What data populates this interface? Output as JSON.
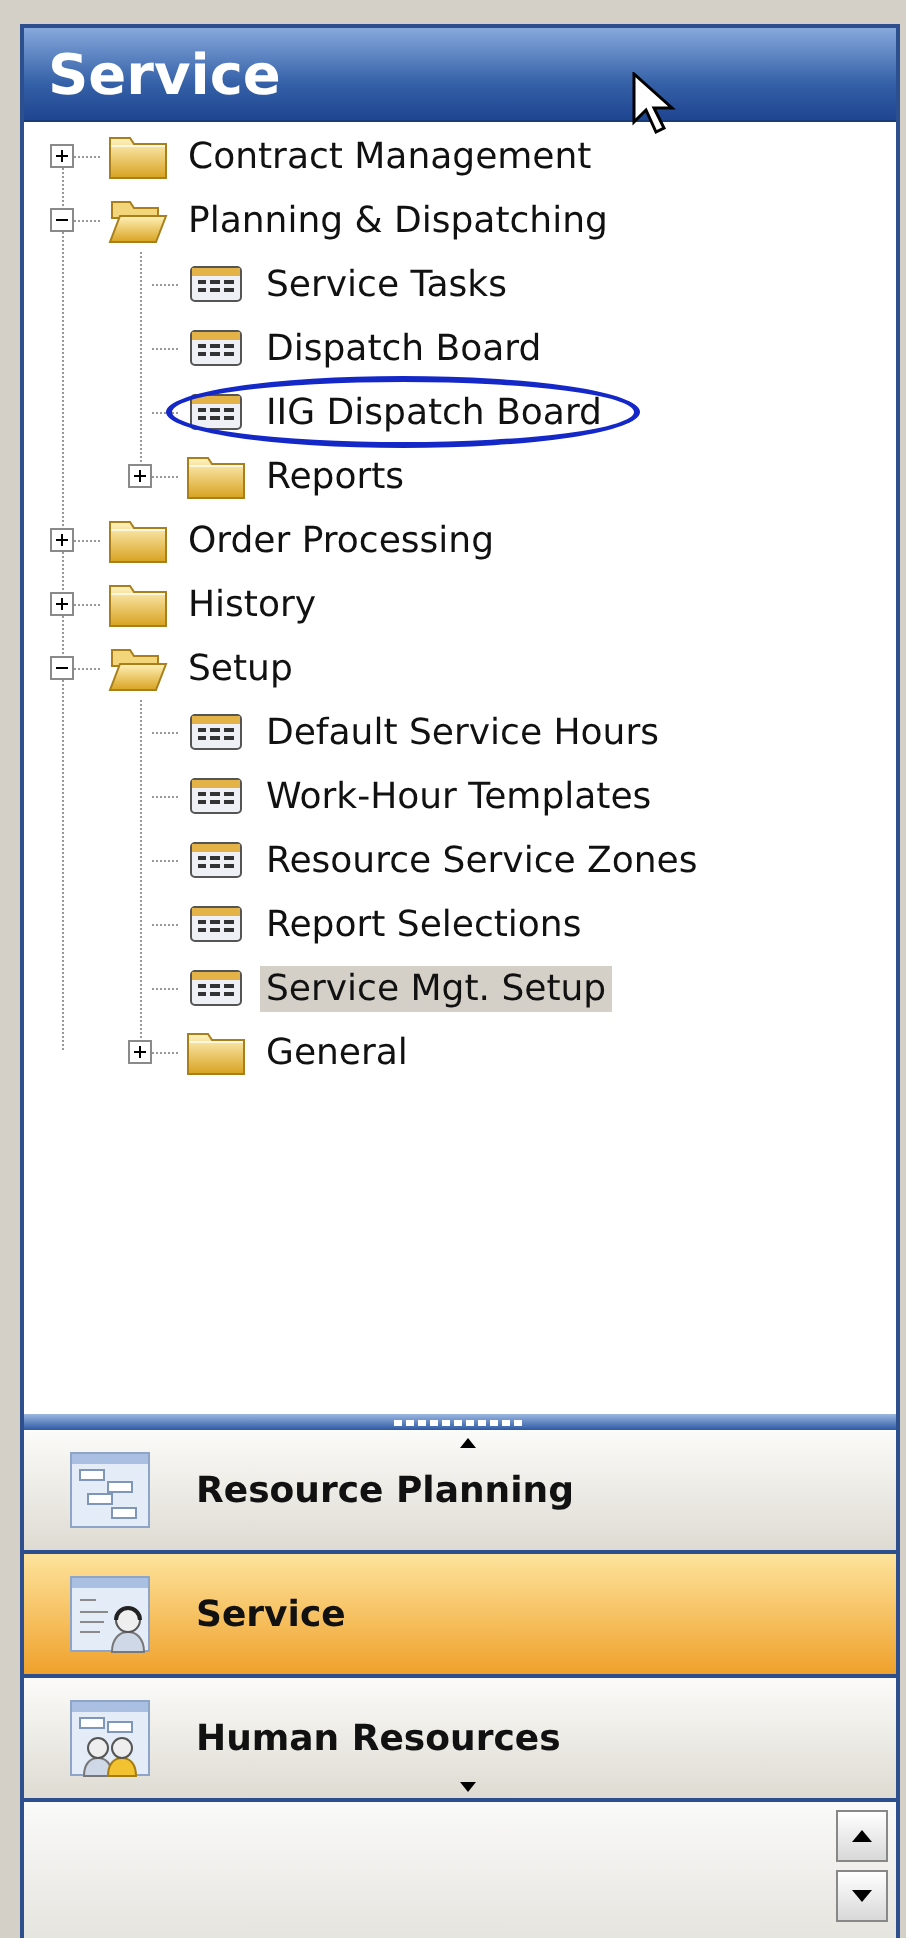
{
  "panel": {
    "title": "Service"
  },
  "tree": [
    {
      "label": "Contract Management",
      "kind": "folder",
      "expanded": false,
      "selected": false
    },
    {
      "label": "Planning & Dispatching",
      "kind": "folder",
      "expanded": true,
      "selected": false,
      "children": [
        {
          "label": "Service Tasks",
          "kind": "form",
          "selected": false
        },
        {
          "label": "Dispatch Board",
          "kind": "form",
          "selected": false
        },
        {
          "label": "IIG Dispatch Board",
          "kind": "form",
          "selected": false,
          "circled": true
        },
        {
          "label": "Reports",
          "kind": "folder",
          "expanded": false,
          "selected": false
        }
      ]
    },
    {
      "label": "Order Processing",
      "kind": "folder",
      "expanded": false,
      "selected": false
    },
    {
      "label": "History",
      "kind": "folder",
      "expanded": false,
      "selected": false
    },
    {
      "label": "Setup",
      "kind": "folder",
      "expanded": true,
      "selected": false,
      "children": [
        {
          "label": "Default Service Hours",
          "kind": "form",
          "selected": false
        },
        {
          "label": "Work-Hour Templates",
          "kind": "form",
          "selected": false
        },
        {
          "label": "Resource Service Zones",
          "kind": "form",
          "selected": false
        },
        {
          "label": "Report Selections",
          "kind": "form",
          "selected": false
        },
        {
          "label": "Service Mgt. Setup",
          "kind": "form",
          "selected": true
        },
        {
          "label": "General",
          "kind": "folder",
          "expanded": false,
          "selected": false
        }
      ]
    }
  ],
  "nav_buttons": [
    {
      "label": "Resource Planning",
      "kind": "planning",
      "selected": false
    },
    {
      "label": "Service",
      "kind": "service",
      "selected": true
    },
    {
      "label": "Human Resources",
      "kind": "people",
      "selected": false
    }
  ]
}
